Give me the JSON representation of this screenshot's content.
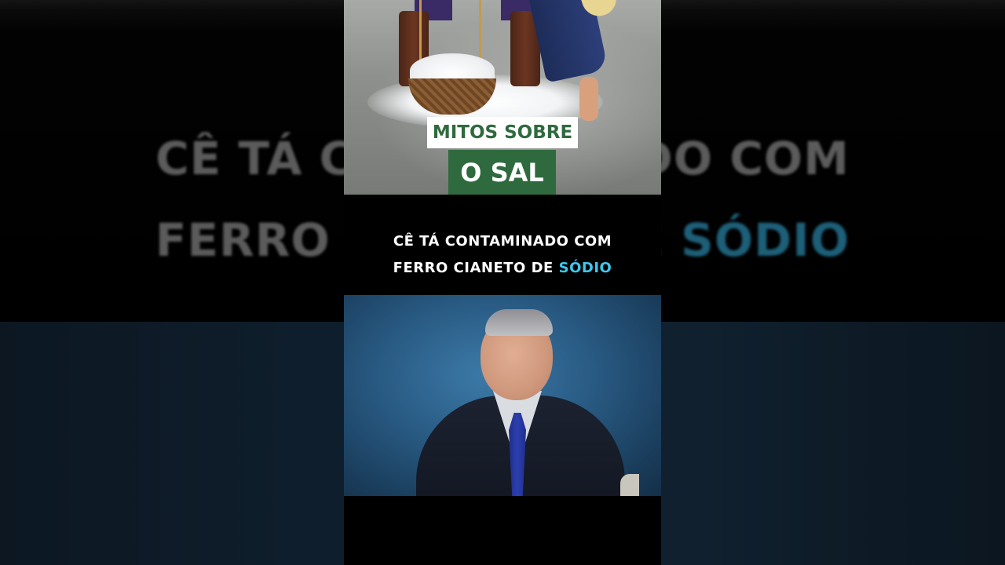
{
  "background": {
    "line1": "CÊ TÁ CONTAMINADO COM",
    "line2_before": "FERRO CIANETO DE ",
    "line2_highlight": "SÓDIO"
  },
  "title": {
    "line1": "MITOS SOBRE",
    "line2": "O SAL"
  },
  "caption": {
    "line1": "CÊ TÁ CONTAMINADO COM",
    "line2_before": "FERRO CIANETO DE ",
    "line2_highlight": "SÓDIO"
  },
  "colors": {
    "title_green": "#2f6a3e",
    "caption_highlight": "#3dc8ef"
  }
}
